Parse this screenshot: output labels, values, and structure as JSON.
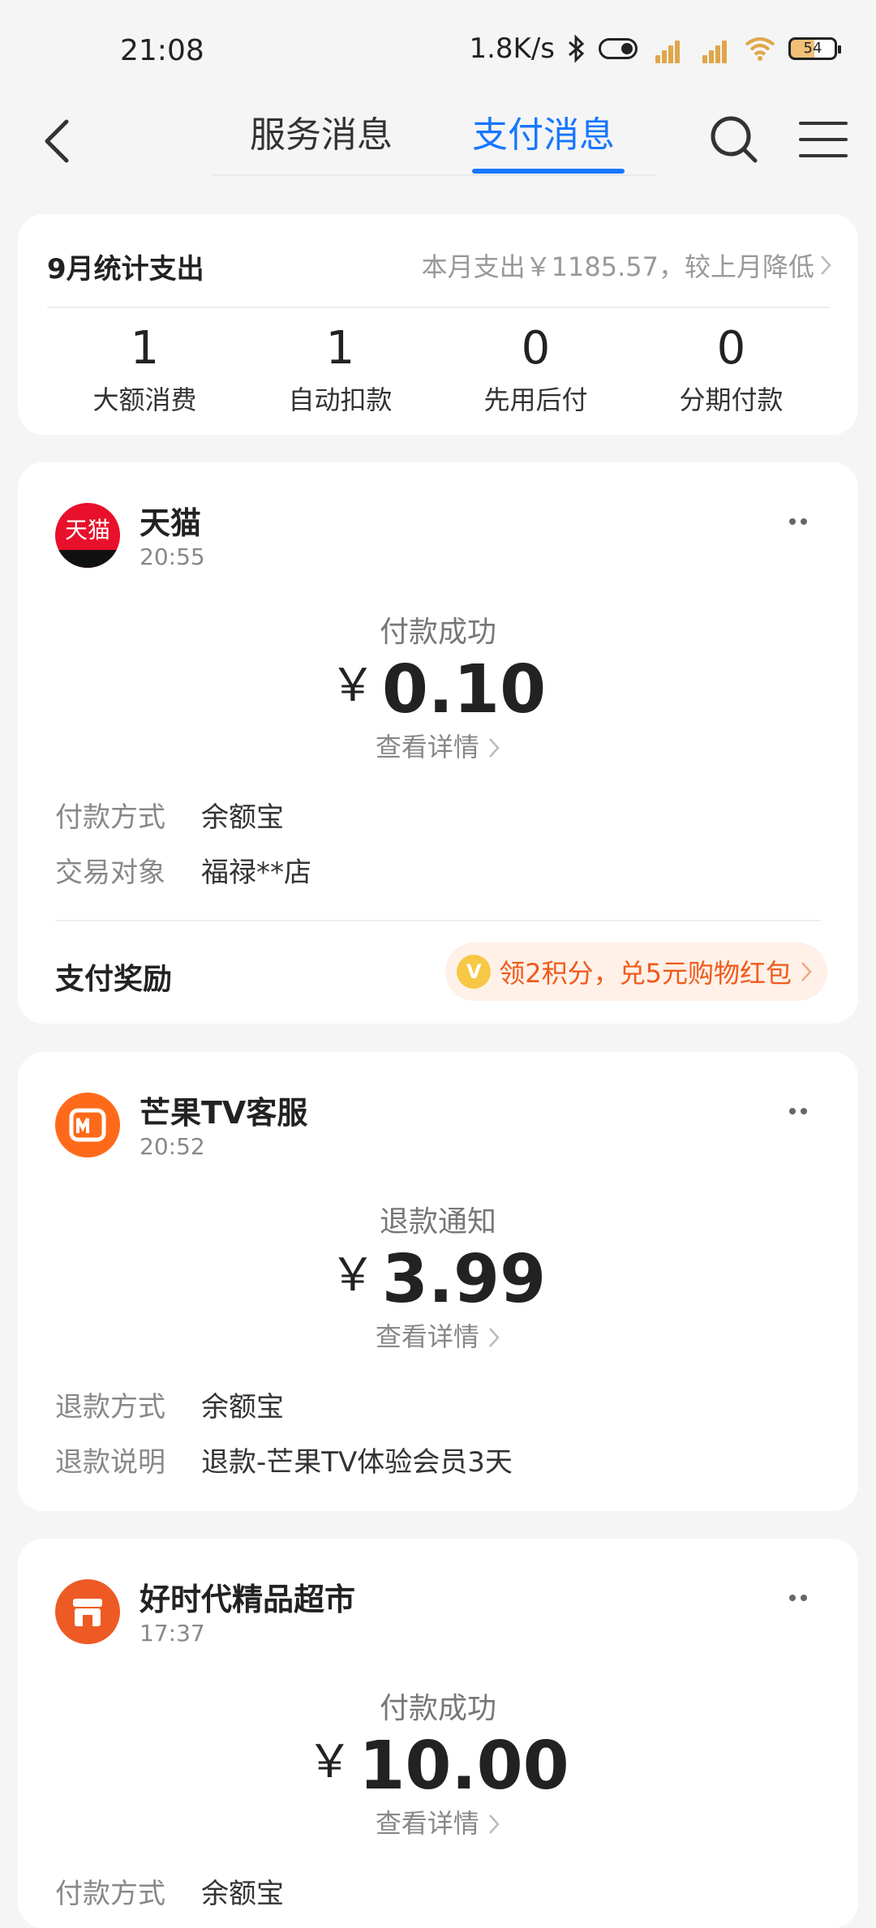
{
  "status_bar": {
    "time": "21:08",
    "net_speed": "1.8K/s",
    "battery": "54"
  },
  "header": {
    "tabs": [
      {
        "label": "服务消息",
        "active": false
      },
      {
        "label": "支付消息",
        "active": true
      }
    ],
    "accent_color": "#1677ff"
  },
  "summary": {
    "title": "9月统计支出",
    "link": "本月支出￥1185.57，较上月降低",
    "stats": [
      {
        "value": "1",
        "label": "大额消费"
      },
      {
        "value": "1",
        "label": "自动扣款"
      },
      {
        "value": "0",
        "label": "先用后付"
      },
      {
        "value": "0",
        "label": "分期付款"
      }
    ]
  },
  "messages": [
    {
      "merchant": "天猫",
      "logo_text": "天猫",
      "time": "20:55",
      "status": "付款成功",
      "currency": "￥",
      "amount": "0.10",
      "detail": "查看详情",
      "rows": [
        {
          "key": "付款方式",
          "value": "余额宝"
        },
        {
          "key": "交易对象",
          "value": "福禄**店"
        }
      ],
      "reward_title": "支付奖励",
      "reward_text": "领2积分，兑5元购物红包"
    },
    {
      "merchant": "芒果TV客服",
      "time": "20:52",
      "status": "退款通知",
      "currency": "￥",
      "amount": "3.99",
      "detail": "查看详情",
      "rows": [
        {
          "key": "退款方式",
          "value": "余额宝"
        },
        {
          "key": "退款说明",
          "value": "退款-芒果TV体验会员3天"
        }
      ]
    },
    {
      "merchant": "好时代精品超市",
      "time": "17:37",
      "status": "付款成功",
      "currency": "￥",
      "amount": "10.00",
      "detail": "查看详情",
      "rows": [
        {
          "key": "付款方式",
          "value": "余额宝"
        }
      ]
    }
  ]
}
